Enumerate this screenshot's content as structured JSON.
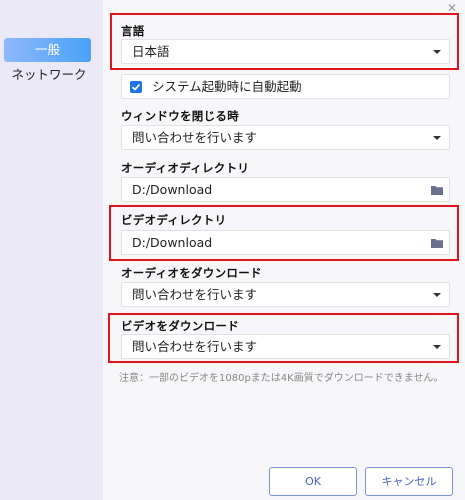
{
  "sidebar": {
    "items": [
      {
        "label": "一般",
        "active": true
      },
      {
        "label": "ネットワーク",
        "active": false
      }
    ]
  },
  "language": {
    "label": "言語",
    "value": "日本語"
  },
  "autostart": {
    "label": "システム起動時に自動起動",
    "checked": true
  },
  "on_close": {
    "label": "ウィンドウを閉じる時",
    "value": "問い合わせを行います"
  },
  "audio_dir": {
    "label": "オーディオディレクトリ",
    "value": "D:/Download"
  },
  "video_dir": {
    "label": "ビデオディレクトリ",
    "value": "D:/Download"
  },
  "audio_download": {
    "label": "オーディオをダウンロード",
    "value": "問い合わせを行います"
  },
  "video_download": {
    "label": "ビデオをダウンロード",
    "value": "問い合わせを行います"
  },
  "note": "注意：一部のビデオを1080pまたは4K画質でダウンロードできません。",
  "buttons": {
    "ok": "OK",
    "cancel": "キャンセル"
  },
  "icons": {
    "close": "close-icon",
    "folder": "folder-icon",
    "dropdown": "chevron-down-icon",
    "check": "check-icon"
  },
  "colors": {
    "accent": "#4aa2f9",
    "sidebar_bg": "#ebe9f8",
    "highlight": "#e0141b",
    "checkbox": "#1c74e8",
    "button_border": "#7c93d6"
  }
}
